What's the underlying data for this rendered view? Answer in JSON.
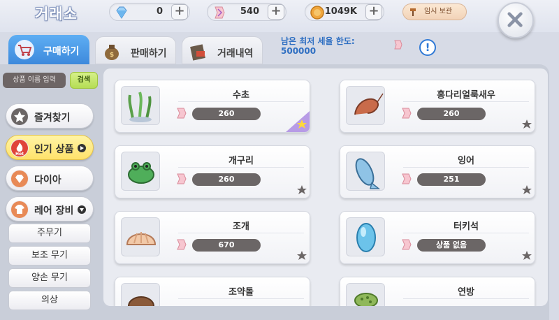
{
  "header": {
    "title": "거래소",
    "currencies": [
      {
        "icon": "diamond-icon",
        "value": "0"
      },
      {
        "icon": "feather-ticket-icon",
        "value": "540"
      },
      {
        "icon": "gold-coin-icon",
        "value": "1049K"
      }
    ],
    "plus_label": "+",
    "storage_label": "임시 보관",
    "close_label": "×"
  },
  "tabs": [
    {
      "label": "구매하기",
      "icon": "cart-icon",
      "active": true
    },
    {
      "label": "판매하기",
      "icon": "money-bag-icon",
      "active": false
    },
    {
      "label": "거래내역",
      "icon": "history-book-icon",
      "active": false
    }
  ],
  "limit": {
    "label": "남은 최저 세율 한도:",
    "value": "500000",
    "info": "!"
  },
  "search": {
    "placeholder": "상품 이름 입력",
    "button_label": "검색"
  },
  "categories": [
    {
      "label": "즐겨찾기",
      "icon": "star-icon"
    },
    {
      "label": "인기 상품",
      "icon": "hot-icon",
      "badge": "Hot",
      "selected": true
    },
    {
      "label": "다이아",
      "icon": "diamond-icon"
    },
    {
      "label": "레어 장비",
      "icon": "shirt-icon",
      "expanded": true
    }
  ],
  "subcategories": [
    "주무기",
    "보조 무기",
    "양손 무기",
    "의상"
  ],
  "items": [
    {
      "name": "수초",
      "price": "260",
      "favorite": true
    },
    {
      "name": "홍다리얼룩새우",
      "price": "260",
      "favorite": false
    },
    {
      "name": "개구리",
      "price": "260",
      "favorite": false
    },
    {
      "name": "잉어",
      "price": "251",
      "favorite": false
    },
    {
      "name": "조개",
      "price": "670",
      "favorite": false
    },
    {
      "name": "터키석",
      "price": "상품 없음",
      "favorite": false
    },
    {
      "name": "조약돌",
      "price": "",
      "favorite": false
    },
    {
      "name": "연방",
      "price": "",
      "favorite": false
    }
  ],
  "colors": {
    "accent_blue": "#3d89dc",
    "fav_active": "#b79be6",
    "price_pill": "#6b6666"
  }
}
